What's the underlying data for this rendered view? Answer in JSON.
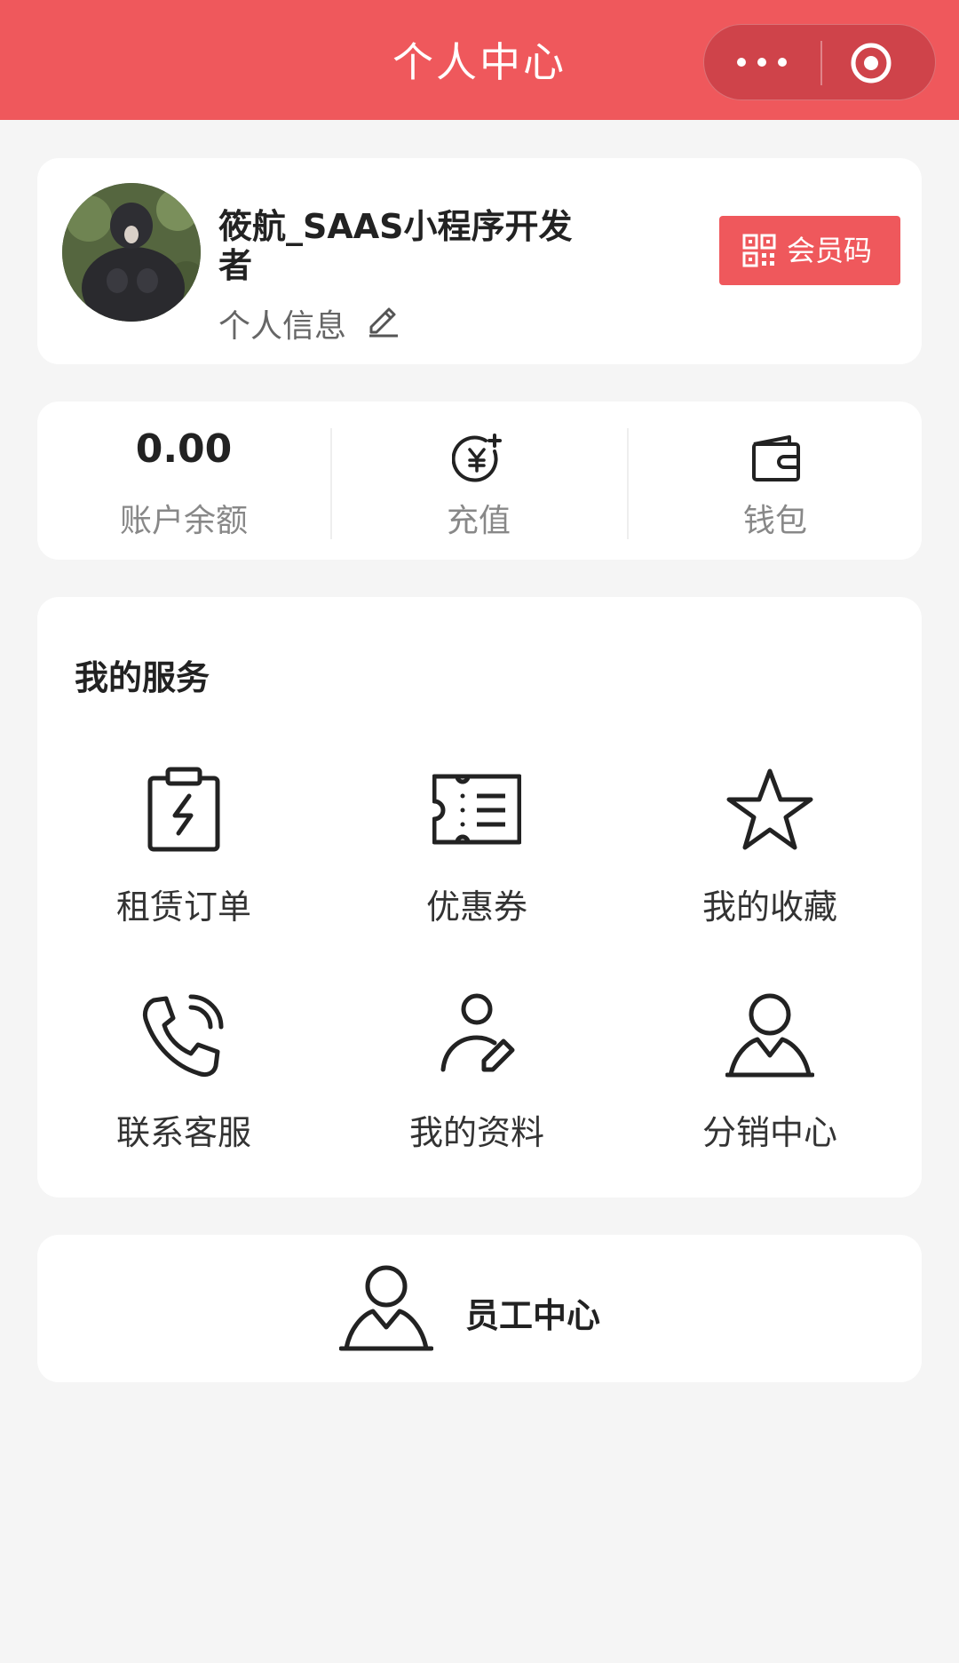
{
  "navbar": {
    "title": "个人中心",
    "bg_color": "#ef585c",
    "more_icon": "more-dots-icon",
    "close_icon": "target-close-icon"
  },
  "profile": {
    "name": "筱航_SAAS小程序开发者",
    "info_link": "个人信息",
    "edit_icon": "pencil-icon",
    "member_button": "会员码",
    "member_icon": "qr-code-icon"
  },
  "account": {
    "balance_value": "0.00",
    "balance_label": "账户余额",
    "recharge_label": "充值",
    "recharge_icon": "yen-plus-icon",
    "wallet_label": "钱包",
    "wallet_icon": "wallet-icon"
  },
  "services": {
    "title": "我的服务",
    "items": [
      {
        "label": "租赁订单",
        "icon": "clipboard-bolt-icon"
      },
      {
        "label": "优惠券",
        "icon": "coupon-icon"
      },
      {
        "label": "我的收藏",
        "icon": "star-icon"
      },
      {
        "label": "联系客服",
        "icon": "phone-call-icon"
      },
      {
        "label": "我的资料",
        "icon": "user-edit-icon"
      },
      {
        "label": "分销中心",
        "icon": "user-icon"
      }
    ]
  },
  "staff": {
    "label": "员工中心",
    "icon": "user-icon"
  }
}
